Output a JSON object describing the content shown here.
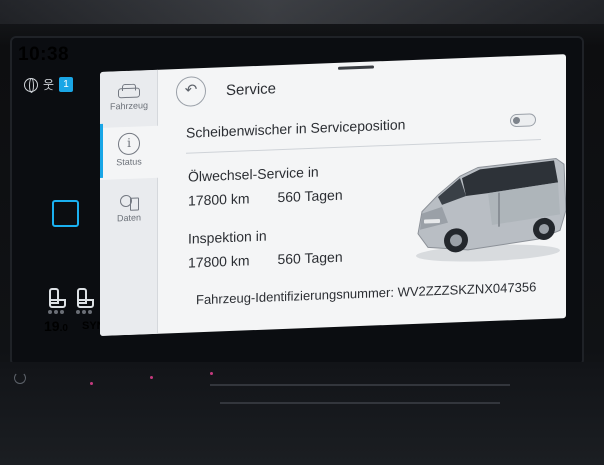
{
  "status_bar": {
    "clock": "10:38",
    "badge_count": "1",
    "temperature_main": "19",
    "temperature_decimal": ".0",
    "sync_label": "SYNC"
  },
  "sidebar": {
    "items": [
      {
        "label": "Fahrzeug",
        "icon": "car-icon"
      },
      {
        "label": "Status",
        "icon": "info-icon",
        "active": true
      },
      {
        "label": "Daten",
        "icon": "data-icon"
      }
    ]
  },
  "header": {
    "back_icon": "back-arrow-icon",
    "back_glyph": "↶",
    "title": "Service"
  },
  "settings": {
    "wiper_label": "Scheibenwischer in Serviceposition",
    "wiper_enabled": false
  },
  "oil_service": {
    "label": "Ölwechsel-Service in",
    "distance": "17800 km",
    "days": "560 Tagen"
  },
  "inspection": {
    "label": "Inspektion in",
    "distance": "17800 km",
    "days": "560 Tagen"
  },
  "vehicle": {
    "vin_text": "Fahrzeug-Identifizierungsnummer: WV2ZZZSKZNX047356"
  },
  "colors": {
    "accent": "#1aa6e6",
    "screen_bg": "#f4f5f6",
    "text": "#2b2e33"
  }
}
